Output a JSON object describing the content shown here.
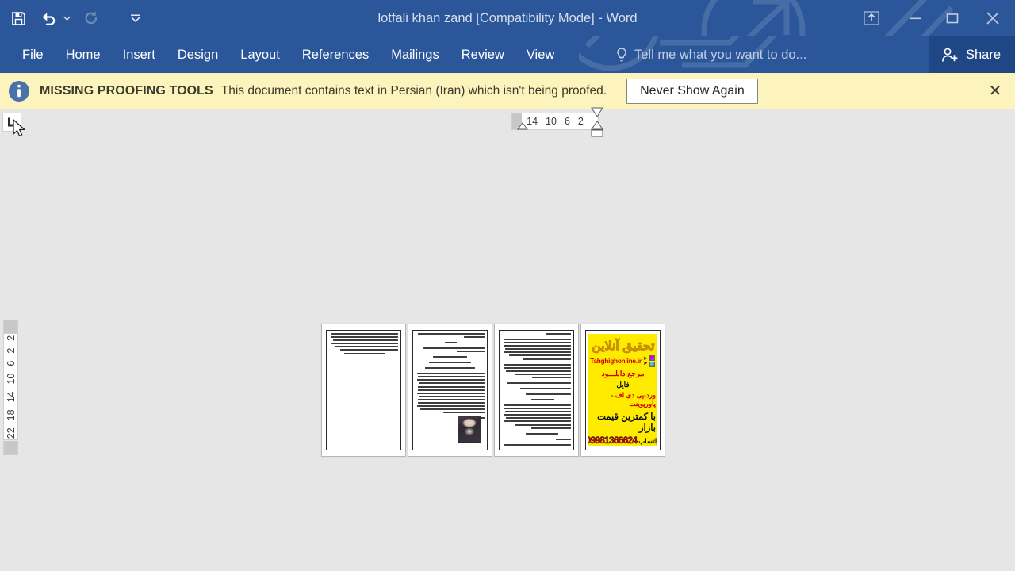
{
  "window": {
    "title": "lotfali khan zand [Compatibility Mode] - Word",
    "titlebar_color": "#2b579a"
  },
  "quick_access_toolbar": {
    "items": [
      {
        "name": "save",
        "icon": "save-icon",
        "enabled": true
      },
      {
        "name": "undo",
        "icon": "undo-icon",
        "enabled": true,
        "has_dropdown": true
      },
      {
        "name": "redo",
        "icon": "redo-icon",
        "enabled": false
      },
      {
        "name": "customize",
        "icon": "customize-quick-access-toolbar-icon",
        "enabled": true
      }
    ]
  },
  "window_controls": {
    "ribbon_display_options": "ribbon-display-options-icon",
    "minimize": "minimize-icon",
    "restore": "restore-icon",
    "close": "close-icon"
  },
  "ribbon": {
    "tabs": [
      {
        "label": "File"
      },
      {
        "label": "Home"
      },
      {
        "label": "Insert"
      },
      {
        "label": "Design"
      },
      {
        "label": "Layout"
      },
      {
        "label": "References"
      },
      {
        "label": "Mailings"
      },
      {
        "label": "Review"
      },
      {
        "label": "View"
      }
    ],
    "tell_me": "Tell me what you want to do...",
    "share_label": "Share"
  },
  "message_bar": {
    "icon": "info-icon",
    "strong": "MISSING PROOFING TOOLS",
    "text": "This document contains text in Persian (Iran) which isn't being proofed.",
    "button": "Never Show Again",
    "close": "✕",
    "background": "#fdf4bd"
  },
  "rulers": {
    "tab_selector": "left-tab-stop-icon",
    "horizontal_ticks": [
      "14",
      "10",
      "6",
      "2"
    ],
    "vertical_ticks": [
      "2",
      "2",
      "6",
      "10",
      "14",
      "18",
      "22"
    ]
  },
  "document": {
    "pages": [
      {
        "number": 1,
        "type": "text",
        "paragraphs": [
          {
            "lines": [
              96,
              98,
              94,
              97,
              92,
              84,
              60
            ]
          }
        ]
      },
      {
        "number": 2,
        "type": "text-with-image",
        "paragraphs": [
          {
            "lines": [
              97,
              30
            ]
          },
          {
            "lines": [
              18
            ]
          },
          {
            "lines": [
              88,
              40
            ]
          },
          {
            "lines": [
              50
            ]
          },
          {
            "lines": [
              62
            ]
          },
          {
            "lines": [
              70
            ]
          },
          {
            "lines": [
              98,
              96,
              98,
              95,
              97,
              96,
              98,
              94,
              97,
              96,
              98,
              93,
              60
            ]
          },
          {
            "lines": [
              12
            ]
          }
        ],
        "image": "portrait-image"
      },
      {
        "number": 3,
        "type": "text",
        "paragraphs": [
          {
            "lines": [
              36
            ]
          },
          {
            "lines": [
              97,
              96,
              98,
              95,
              97,
              90,
              70
            ]
          },
          {
            "lines": [
              96,
              97,
              94,
              82,
              56
            ]
          },
          {
            "lines": [
              92
            ]
          },
          {
            "lines": [
              74
            ]
          },
          {
            "lines": [
              66
            ]
          },
          {
            "lines": [
              34
            ]
          },
          {
            "lines": [
              96,
              98,
              95,
              97,
              94,
              96,
              80,
              58
            ]
          },
          {
            "lines": [
              48
            ]
          },
          {
            "lines": [
              22
            ]
          },
          {
            "lines": [
              96,
              92
            ]
          }
        ]
      },
      {
        "number": 4,
        "type": "advertisement",
        "ad": {
          "background": "#ffeb00",
          "logo": "تحقیق آنلاین",
          "website": "Tahghighonline.ir",
          "line2": "مرجع دانلـــود",
          "line3": "فایل",
          "line4": "ورد-پی دی اف - پاورپوینت",
          "line5": "با کمترین قیمت بازار",
          "phone": "09981366624",
          "whatsapp": "واتساپ",
          "accent_red": "#d40000"
        }
      }
    ]
  }
}
